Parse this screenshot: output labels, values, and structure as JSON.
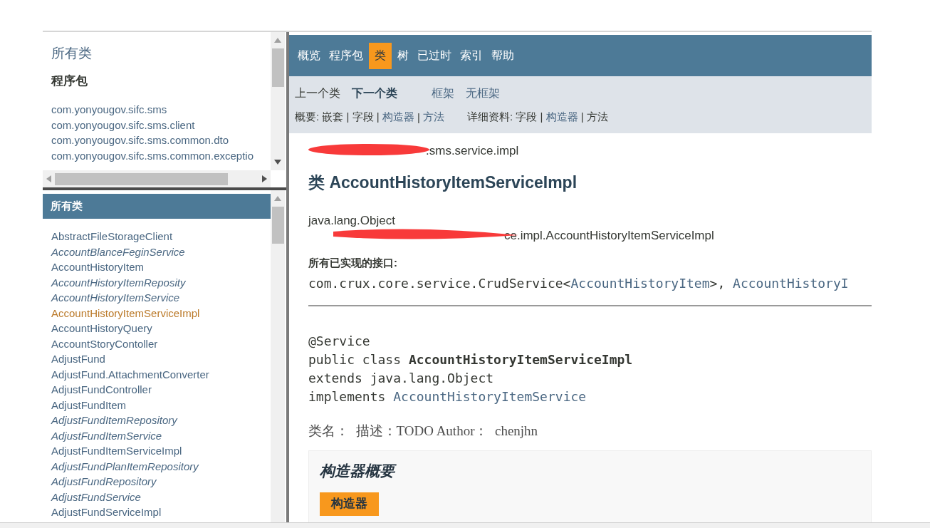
{
  "package_frame": {
    "title": "所有类",
    "heading": "程序包",
    "packages": [
      "com.yonyougov.sifc.sms",
      "com.yonyougov.sifc.sms.client",
      "com.yonyougov.sifc.sms.common.dto",
      "com.yonyougov.sifc.sms.common.exceptio"
    ]
  },
  "class_frame": {
    "header": "所有类",
    "classes": [
      {
        "name": "AbstractFileStorageClient",
        "kind": "class",
        "selected": false
      },
      {
        "name": "AccountBlanceFeginService",
        "kind": "interface",
        "selected": false
      },
      {
        "name": "AccountHistoryItem",
        "kind": "class",
        "selected": false
      },
      {
        "name": "AccountHistoryItemReposity",
        "kind": "interface",
        "selected": false
      },
      {
        "name": "AccountHistoryItemService",
        "kind": "interface",
        "selected": false
      },
      {
        "name": "AccountHistoryItemServiceImpl",
        "kind": "class",
        "selected": true
      },
      {
        "name": "AccountHistoryQuery",
        "kind": "class",
        "selected": false
      },
      {
        "name": "AccountStoryContoller",
        "kind": "class",
        "selected": false
      },
      {
        "name": "AdjustFund",
        "kind": "class",
        "selected": false
      },
      {
        "name": "AdjustFund.AttachmentConverter",
        "kind": "class",
        "selected": false
      },
      {
        "name": "AdjustFundController",
        "kind": "class",
        "selected": false
      },
      {
        "name": "AdjustFundItem",
        "kind": "class",
        "selected": false
      },
      {
        "name": "AdjustFundItemRepository",
        "kind": "interface",
        "selected": false
      },
      {
        "name": "AdjustFundItemService",
        "kind": "interface",
        "selected": false
      },
      {
        "name": "AdjustFundItemServiceImpl",
        "kind": "class",
        "selected": false
      },
      {
        "name": "AdjustFundPlanItemRepository",
        "kind": "interface",
        "selected": false
      },
      {
        "name": "AdjustFundRepository",
        "kind": "interface",
        "selected": false
      },
      {
        "name": "AdjustFundService",
        "kind": "interface",
        "selected": false
      },
      {
        "name": "AdjustFundServiceImpl",
        "kind": "class",
        "selected": false
      }
    ]
  },
  "nav": {
    "items": [
      {
        "label": "概览",
        "selected": false
      },
      {
        "label": "程序包",
        "selected": false
      },
      {
        "label": "类",
        "selected": true
      },
      {
        "label": "树",
        "selected": false
      },
      {
        "label": "已过时",
        "selected": false
      },
      {
        "label": "索引",
        "selected": false
      },
      {
        "label": "帮助",
        "selected": false
      }
    ],
    "subnav": [
      {
        "label": "上一个类",
        "kind": "disabled"
      },
      {
        "label": "下一个类",
        "kind": "strong"
      },
      {
        "label": "框架",
        "kind": "link"
      },
      {
        "label": "无框架",
        "kind": "link"
      }
    ],
    "summary": [
      {
        "text": "概要: 嵌套 | 字段 | ",
        "link": false
      },
      {
        "text": "构造器",
        "link": true
      },
      {
        "text": " | ",
        "link": false
      },
      {
        "text": "方法",
        "link": true
      }
    ],
    "detail": [
      {
        "text": "详细资料: 字段 | ",
        "link": false
      },
      {
        "text": "构造器",
        "link": true
      },
      {
        "text": " | 方法",
        "link": false
      }
    ]
  },
  "content": {
    "package": ".sms.service.impl",
    "title": "类 AccountHistoryItemServiceImpl",
    "inheritance": [
      "java.lang.Object",
      "ce.impl.AccountHistoryItemServiceImpl"
    ],
    "interfaces_label": "所有已实现的接口:",
    "interfaces": [
      {
        "text": "com.crux.core.service.CrudService<",
        "link": false
      },
      {
        "text": "AccountHistoryItem",
        "link": true
      },
      {
        "text": ">, ",
        "link": false
      },
      {
        "text": "AccountHistoryI",
        "link": true
      }
    ],
    "signature": [
      [
        {
          "text": "@Service",
          "kind": "plain"
        }
      ],
      [
        {
          "text": "public class ",
          "kind": "plain"
        },
        {
          "text": "AccountHistoryItemServiceImpl",
          "kind": "bold"
        }
      ],
      [
        {
          "text": "extends java.lang.Object",
          "kind": "plain"
        }
      ],
      [
        {
          "text": "implements ",
          "kind": "plain"
        },
        {
          "text": "AccountHistoryItemService",
          "kind": "link"
        }
      ]
    ],
    "description": "类名：  描述：TODO Author：  chenjhn",
    "constructor_summary": {
      "title": "构造器概要",
      "tab": "构造器"
    }
  }
}
